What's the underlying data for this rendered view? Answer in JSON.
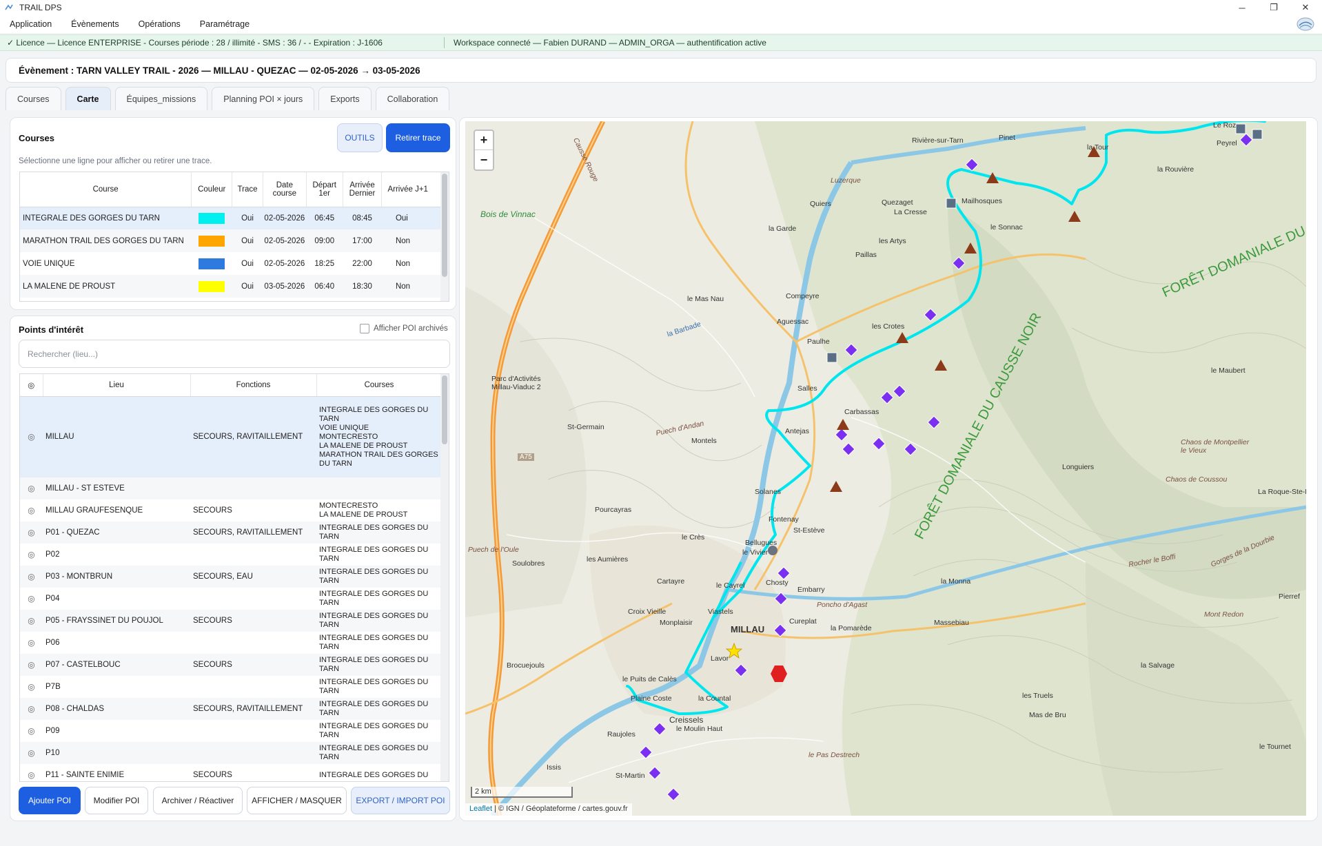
{
  "window": {
    "title": "TRAIL DPS",
    "minimize": "─",
    "maximize": "❐",
    "close": "✕"
  },
  "menu": [
    "Application",
    "Évènements",
    "Opérations",
    "Paramétrage"
  ],
  "status": {
    "license": "✓ Licence — Licence ENTERPRISE - Courses période : 28 / illimité - SMS : 36 / - - Expiration : J-1606",
    "workspace": "Workspace connecté — Fabien DURAND — ADMIN_ORGA — authentification active"
  },
  "event": {
    "label": "Évènement : TARN VALLEY TRAIL - 2026 — MILLAU - QUEZAC — 02-05-2026 → 03-05-2026"
  },
  "tabs": [
    "Courses",
    "Carte",
    "Équipes_missions",
    "Planning POI × jours",
    "Exports",
    "Collaboration"
  ],
  "active_tab": "Carte",
  "courses_panel": {
    "title": "Courses",
    "tools_button": "OUTILS",
    "remove_trace_button": "Retirer trace",
    "hint": "Sélectionne une ligne pour afficher ou retirer une trace.",
    "headers": [
      "Course",
      "Couleur",
      "Trace",
      "Date course",
      "Départ 1er",
      "Arrivée Dernier",
      "Arrivée J+1"
    ],
    "rows": [
      {
        "name": "INTEGRALE DES GORGES DU TARN",
        "color": "#00f0f0",
        "trace": "Oui",
        "date": "02-05-2026",
        "depart": "06:45",
        "arrivee": "08:45",
        "j1": "Oui"
      },
      {
        "name": "MARATHON TRAIL DES GORGES DU TARN",
        "color": "#ffa500",
        "trace": "Oui",
        "date": "02-05-2026",
        "depart": "09:00",
        "arrivee": "17:00",
        "j1": "Non"
      },
      {
        "name": "VOIE UNIQUE",
        "color": "#2e7be0",
        "trace": "Oui",
        "date": "02-05-2026",
        "depart": "18:25",
        "arrivee": "22:00",
        "j1": "Non"
      },
      {
        "name": "LA MALENE DE PROUST",
        "color": "#ffff00",
        "trace": "Oui",
        "date": "03-05-2026",
        "depart": "06:40",
        "arrivee": "18:30",
        "j1": "Non"
      }
    ]
  },
  "poi_panel": {
    "title": "Points d'intérêt",
    "archived_label": "Afficher POI archivés",
    "search_placeholder": "Rechercher (lieu...)",
    "headers": [
      "◎",
      "Lieu",
      "Fonctions",
      "Courses"
    ],
    "rows": [
      {
        "lieu": "MILLAU",
        "fonctions": "SECOURS, RAVITAILLEMENT",
        "courses": "INTEGRALE DES GORGES DU TARN\nVOIE UNIQUE\nMONTECRESTO\nLA MALENE DE PROUST\nMARATHON TRAIL DES GORGES DU TARN"
      },
      {
        "lieu": "MILLAU - ST ESTEVE",
        "fonctions": "",
        "courses": ""
      },
      {
        "lieu": "MILLAU GRAUFESENQUE",
        "fonctions": "SECOURS",
        "courses": "MONTECRESTO\nLA MALENE DE PROUST"
      },
      {
        "lieu": "P01 - QUEZAC",
        "fonctions": "SECOURS, RAVITAILLEMENT",
        "courses": "INTEGRALE DES GORGES DU TARN"
      },
      {
        "lieu": "P02",
        "fonctions": "",
        "courses": "INTEGRALE DES GORGES DU TARN"
      },
      {
        "lieu": "P03 - MONTBRUN",
        "fonctions": "SECOURS, EAU",
        "courses": "INTEGRALE DES GORGES DU TARN"
      },
      {
        "lieu": "P04",
        "fonctions": "",
        "courses": "INTEGRALE DES GORGES DU TARN"
      },
      {
        "lieu": "P05 - FRAYSSINET DU POUJOL",
        "fonctions": "SECOURS",
        "courses": "INTEGRALE DES GORGES DU TARN"
      },
      {
        "lieu": "P06",
        "fonctions": "",
        "courses": "INTEGRALE DES GORGES DU TARN"
      },
      {
        "lieu": "P07 - CASTELBOUC",
        "fonctions": "SECOURS",
        "courses": "INTEGRALE DES GORGES DU TARN"
      },
      {
        "lieu": "P7B",
        "fonctions": "",
        "courses": "INTEGRALE DES GORGES DU TARN"
      },
      {
        "lieu": "P08 - CHALDAS",
        "fonctions": "SECOURS, RAVITAILLEMENT",
        "courses": "INTEGRALE DES GORGES DU TARN"
      },
      {
        "lieu": "P09",
        "fonctions": "",
        "courses": "INTEGRALE DES GORGES DU TARN"
      },
      {
        "lieu": "P10",
        "fonctions": "",
        "courses": "INTEGRALE DES GORGES DU TARN"
      },
      {
        "lieu": "P11 - SAINTE ENIMIE",
        "fonctions": "SECOURS",
        "courses": "INTEGRALE DES GORGES DU"
      }
    ],
    "buttons": {
      "add": "Ajouter POI",
      "edit": "Modifier POI",
      "archive": "Archiver / Réactiver",
      "toggle": "AFFICHER / MASQUER",
      "export": "EXPORT / IMPORT POI"
    }
  },
  "map": {
    "zoom_in": "+",
    "zoom_out": "−",
    "scale": "2 km",
    "attribution_leaflet": "Leaflet",
    "attribution_rest": "| © IGN / Géoplateforme / cartes.gouv.fr",
    "labels": {
      "millau": "MILLAU",
      "creissels": "Creissels",
      "forest1": "FORÊT DOMANIALE DU CAUSSE NOIR",
      "forest2": "FORÊT DOMANIALE DU CA",
      "bois_vinnac": "Bois de Vinnac",
      "riviere": "Rivière-sur-Tarn",
      "pinet": "Pinet",
      "mailhosques": "Mailhosques",
      "compeyre": "Compeyre",
      "aguessac": "Aguessac",
      "paulhe": "Paulhe",
      "carbassas": "Carbassas",
      "solanes": "Solanes",
      "fontenay": "Fontenay",
      "st_esteve": "St-Estève",
      "le_vivier": "le Vivier",
      "chosty": "Chosty",
      "embarry": "Embarry",
      "cureplat": "Cureplat",
      "la_pomarede": "la Pomarède",
      "lavor": "Lavor",
      "la_tour": "la Tour",
      "la_rouviere": "la Rouvière",
      "peyreleau": "Peyrel",
      "le_rozier": "Le Roz",
      "le_sonnac": "le Sonnac",
      "les_artys": "les Artys",
      "paillas": "Paillas",
      "la_garde": "la Garde",
      "quiers": "Quiers",
      "queraget": "Quezaget",
      "la_cresse": "La Cresse",
      "le_mas_nau": "le Mas Nau",
      "les_crotes": "les Crotes",
      "salles": "Salles",
      "antejas": "Antejas",
      "montels": "Montels",
      "st_germain": "St-Germain",
      "pourcayras": "Pourcayras",
      "le_cres": "le Crès",
      "bellugues": "Bellugues",
      "soulobres": "Soulobres",
      "les_aumieres": "les Aumières",
      "le_cayrel": "le Cayrel",
      "cartayre": "Cartayre",
      "croix_vieille": "Croix Vieille",
      "monplaisir": "Monplaisir",
      "viastels": "Viastels",
      "brocuejouls": "Brocuejouls",
      "le_puits_de_cales": "le Puits de Calès",
      "plaine_coste": "Plaine Coste",
      "la_countal": "la Countal",
      "le_moulin_haut": "le Moulin Haut",
      "raujoles": "Raujoles",
      "issis": "Issis",
      "st_martin": "St-Martin",
      "le_pas_destrech": "le Pas Destrech",
      "massebiau": "Massebiau",
      "la_monna": "la Monna",
      "les_truels": "les Truels",
      "mas_de_bru": "Mas de Bru",
      "la_salvage": "la Salvage",
      "le_tournet": "le Tournet",
      "longuiers": "Longuiers",
      "le_maubert": "le Maubert",
      "la_roque_ste_marguerite": "La Roque-Ste-Marguerite",
      "pierref": "Pierref",
      "parc_activites": "Parc d'Activités Millau-Viaduc 2",
      "la_barbade": "la Barbade",
      "luzerque": "Luzerque",
      "puech_andan": "Puech d'Andan",
      "poncho_agast": "Poncho d'Agast",
      "rocher_boffi": "Rocher le Boffi",
      "mont_redon": "Mont Redon",
      "gorges_dourbie": "Gorges de la Dourbie",
      "chaos_montpellier": "Chaos de Montpellier le Vieux",
      "chaos_roussou": "Chaos de Coussou",
      "puech_oule": "Puech de l'Oule",
      "causse_rouge": "Causse Rouge",
      "a75": "A75"
    }
  },
  "colors": {
    "accent": "#1d5fe0",
    "trace_cyan": "#00e5ee",
    "poi_diamond": "#7b2ff0",
    "poi_triangle": "#8b3a1a",
    "poi_square": "#5a6f86",
    "road_orange": "#f39a3a"
  }
}
